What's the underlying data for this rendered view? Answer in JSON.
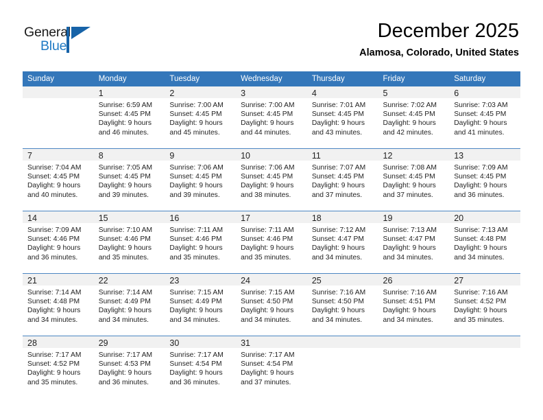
{
  "brand": {
    "name_top": "General",
    "name_bottom": "Blue",
    "accent_color": "#1763a8",
    "blue_text_color": "#1f7ac4"
  },
  "header": {
    "title": "December 2025",
    "subtitle": "Alamosa, Colorado, United States"
  },
  "theme": {
    "header_bg": "#3477ba",
    "daynum_bg": "#f1f1f1",
    "cell_bg": "#ffffff",
    "text_color": "#222222"
  },
  "weekdays": [
    "Sunday",
    "Monday",
    "Tuesday",
    "Wednesday",
    "Thursday",
    "Friday",
    "Saturday"
  ],
  "weeks": [
    [
      {
        "day": ""
      },
      {
        "day": "1",
        "sunrise": "Sunrise: 6:59 AM",
        "sunset": "Sunset: 4:45 PM",
        "daylight1": "Daylight: 9 hours",
        "daylight2": "and 46 minutes."
      },
      {
        "day": "2",
        "sunrise": "Sunrise: 7:00 AM",
        "sunset": "Sunset: 4:45 PM",
        "daylight1": "Daylight: 9 hours",
        "daylight2": "and 45 minutes."
      },
      {
        "day": "3",
        "sunrise": "Sunrise: 7:00 AM",
        "sunset": "Sunset: 4:45 PM",
        "daylight1": "Daylight: 9 hours",
        "daylight2": "and 44 minutes."
      },
      {
        "day": "4",
        "sunrise": "Sunrise: 7:01 AM",
        "sunset": "Sunset: 4:45 PM",
        "daylight1": "Daylight: 9 hours",
        "daylight2": "and 43 minutes."
      },
      {
        "day": "5",
        "sunrise": "Sunrise: 7:02 AM",
        "sunset": "Sunset: 4:45 PM",
        "daylight1": "Daylight: 9 hours",
        "daylight2": "and 42 minutes."
      },
      {
        "day": "6",
        "sunrise": "Sunrise: 7:03 AM",
        "sunset": "Sunset: 4:45 PM",
        "daylight1": "Daylight: 9 hours",
        "daylight2": "and 41 minutes."
      }
    ],
    [
      {
        "day": "7",
        "sunrise": "Sunrise: 7:04 AM",
        "sunset": "Sunset: 4:45 PM",
        "daylight1": "Daylight: 9 hours",
        "daylight2": "and 40 minutes."
      },
      {
        "day": "8",
        "sunrise": "Sunrise: 7:05 AM",
        "sunset": "Sunset: 4:45 PM",
        "daylight1": "Daylight: 9 hours",
        "daylight2": "and 39 minutes."
      },
      {
        "day": "9",
        "sunrise": "Sunrise: 7:06 AM",
        "sunset": "Sunset: 4:45 PM",
        "daylight1": "Daylight: 9 hours",
        "daylight2": "and 39 minutes."
      },
      {
        "day": "10",
        "sunrise": "Sunrise: 7:06 AM",
        "sunset": "Sunset: 4:45 PM",
        "daylight1": "Daylight: 9 hours",
        "daylight2": "and 38 minutes."
      },
      {
        "day": "11",
        "sunrise": "Sunrise: 7:07 AM",
        "sunset": "Sunset: 4:45 PM",
        "daylight1": "Daylight: 9 hours",
        "daylight2": "and 37 minutes."
      },
      {
        "day": "12",
        "sunrise": "Sunrise: 7:08 AM",
        "sunset": "Sunset: 4:45 PM",
        "daylight1": "Daylight: 9 hours",
        "daylight2": "and 37 minutes."
      },
      {
        "day": "13",
        "sunrise": "Sunrise: 7:09 AM",
        "sunset": "Sunset: 4:45 PM",
        "daylight1": "Daylight: 9 hours",
        "daylight2": "and 36 minutes."
      }
    ],
    [
      {
        "day": "14",
        "sunrise": "Sunrise: 7:09 AM",
        "sunset": "Sunset: 4:46 PM",
        "daylight1": "Daylight: 9 hours",
        "daylight2": "and 36 minutes."
      },
      {
        "day": "15",
        "sunrise": "Sunrise: 7:10 AM",
        "sunset": "Sunset: 4:46 PM",
        "daylight1": "Daylight: 9 hours",
        "daylight2": "and 35 minutes."
      },
      {
        "day": "16",
        "sunrise": "Sunrise: 7:11 AM",
        "sunset": "Sunset: 4:46 PM",
        "daylight1": "Daylight: 9 hours",
        "daylight2": "and 35 minutes."
      },
      {
        "day": "17",
        "sunrise": "Sunrise: 7:11 AM",
        "sunset": "Sunset: 4:46 PM",
        "daylight1": "Daylight: 9 hours",
        "daylight2": "and 35 minutes."
      },
      {
        "day": "18",
        "sunrise": "Sunrise: 7:12 AM",
        "sunset": "Sunset: 4:47 PM",
        "daylight1": "Daylight: 9 hours",
        "daylight2": "and 34 minutes."
      },
      {
        "day": "19",
        "sunrise": "Sunrise: 7:13 AM",
        "sunset": "Sunset: 4:47 PM",
        "daylight1": "Daylight: 9 hours",
        "daylight2": "and 34 minutes."
      },
      {
        "day": "20",
        "sunrise": "Sunrise: 7:13 AM",
        "sunset": "Sunset: 4:48 PM",
        "daylight1": "Daylight: 9 hours",
        "daylight2": "and 34 minutes."
      }
    ],
    [
      {
        "day": "21",
        "sunrise": "Sunrise: 7:14 AM",
        "sunset": "Sunset: 4:48 PM",
        "daylight1": "Daylight: 9 hours",
        "daylight2": "and 34 minutes."
      },
      {
        "day": "22",
        "sunrise": "Sunrise: 7:14 AM",
        "sunset": "Sunset: 4:49 PM",
        "daylight1": "Daylight: 9 hours",
        "daylight2": "and 34 minutes."
      },
      {
        "day": "23",
        "sunrise": "Sunrise: 7:15 AM",
        "sunset": "Sunset: 4:49 PM",
        "daylight1": "Daylight: 9 hours",
        "daylight2": "and 34 minutes."
      },
      {
        "day": "24",
        "sunrise": "Sunrise: 7:15 AM",
        "sunset": "Sunset: 4:50 PM",
        "daylight1": "Daylight: 9 hours",
        "daylight2": "and 34 minutes."
      },
      {
        "day": "25",
        "sunrise": "Sunrise: 7:16 AM",
        "sunset": "Sunset: 4:50 PM",
        "daylight1": "Daylight: 9 hours",
        "daylight2": "and 34 minutes."
      },
      {
        "day": "26",
        "sunrise": "Sunrise: 7:16 AM",
        "sunset": "Sunset: 4:51 PM",
        "daylight1": "Daylight: 9 hours",
        "daylight2": "and 34 minutes."
      },
      {
        "day": "27",
        "sunrise": "Sunrise: 7:16 AM",
        "sunset": "Sunset: 4:52 PM",
        "daylight1": "Daylight: 9 hours",
        "daylight2": "and 35 minutes."
      }
    ],
    [
      {
        "day": "28",
        "sunrise": "Sunrise: 7:17 AM",
        "sunset": "Sunset: 4:52 PM",
        "daylight1": "Daylight: 9 hours",
        "daylight2": "and 35 minutes."
      },
      {
        "day": "29",
        "sunrise": "Sunrise: 7:17 AM",
        "sunset": "Sunset: 4:53 PM",
        "daylight1": "Daylight: 9 hours",
        "daylight2": "and 36 minutes."
      },
      {
        "day": "30",
        "sunrise": "Sunrise: 7:17 AM",
        "sunset": "Sunset: 4:54 PM",
        "daylight1": "Daylight: 9 hours",
        "daylight2": "and 36 minutes."
      },
      {
        "day": "31",
        "sunrise": "Sunrise: 7:17 AM",
        "sunset": "Sunset: 4:54 PM",
        "daylight1": "Daylight: 9 hours",
        "daylight2": "and 37 minutes."
      },
      {
        "day": ""
      },
      {
        "day": ""
      },
      {
        "day": ""
      }
    ]
  ]
}
